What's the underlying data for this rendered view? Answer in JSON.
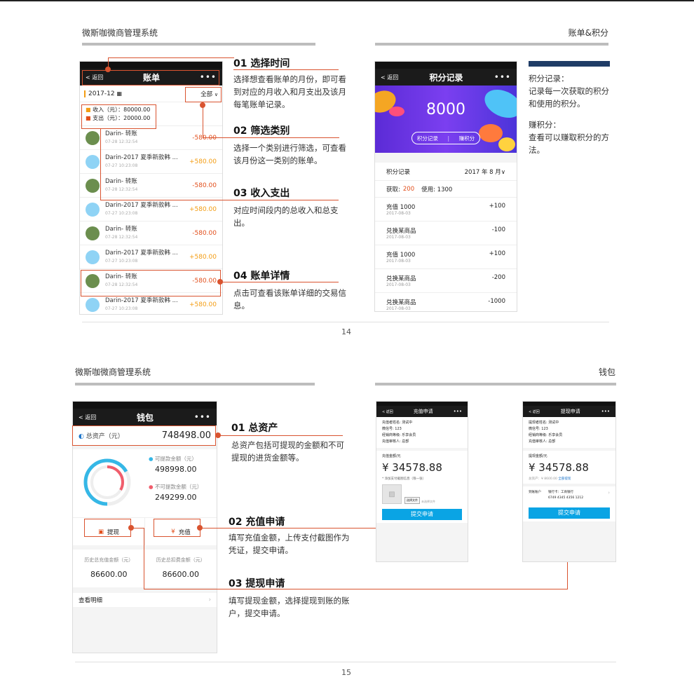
{
  "page14": {
    "left_header": "微斯咖微商管理系统",
    "right_header": "账单&积分",
    "page_number": "14",
    "bill_phone": {
      "back": "< 返回",
      "title": "账单",
      "more": "•••",
      "date": "2017-12",
      "filter": "全部",
      "income": "收入（元）：80000.00",
      "expense": "支出（元）：20000.00",
      "rows": [
        {
          "name": "Darin- 转账",
          "time": "07-28  12:32:54",
          "amount": "-580.00",
          "type": "neg"
        },
        {
          "name": "Darin-2017 夏季新款韩 ...",
          "time": "07-27  10:23:08",
          "amount": "+580.00",
          "type": "pos"
        },
        {
          "name": "Darin- 转账",
          "time": "07-28  12:32:54",
          "amount": "-580.00",
          "type": "neg"
        },
        {
          "name": "Darin-2017 夏季新款韩 ...",
          "time": "07-27  10:23:08",
          "amount": "+580.00",
          "type": "pos"
        },
        {
          "name": "Darin- 转账",
          "time": "07-28  12:32:54",
          "amount": "-580.00",
          "type": "neg"
        },
        {
          "name": "Darin-2017 夏季新款韩 ...",
          "time": "07-27  10:23:08",
          "amount": "+580.00",
          "type": "pos"
        },
        {
          "name": "Darin- 转账",
          "time": "07-28  12:32:54",
          "amount": "-580.00",
          "type": "neg"
        },
        {
          "name": "Darin-2017 夏季新款韩 ...",
          "time": "07-27  10:23:08",
          "amount": "+580.00",
          "type": "pos"
        }
      ]
    },
    "callouts": [
      {
        "title": "01 选择时间",
        "text": "选择想查看账单的月份，即可看到对应的月收入和月支出及该月每笔账单记录。"
      },
      {
        "title": "02 筛选类别",
        "text": "选择一个类别进行筛选，可查看该月份这一类别的账单。"
      },
      {
        "title": "03 收入支出",
        "text": "对应时间段内的总收入和总支出。"
      },
      {
        "title": "04 账单详情",
        "text": "点击可查看该账单详细的交易信息。"
      }
    ],
    "points_phone": {
      "back": "< 返回",
      "title": "积分记录",
      "more": "•••",
      "points": "8000",
      "btn_records": "积分记录",
      "btn_earn": "赚积分",
      "section_label": "积分记录",
      "section_date": "2017 年 8 月∨",
      "earned_label": "获取:",
      "earned_value": "200",
      "used_label": "使用: 1300",
      "rows": [
        {
          "name": "充值 1000",
          "date": "2017-08-03",
          "value": "+100"
        },
        {
          "name": "兑换某商品",
          "date": "2017-08-03",
          "value": "-100"
        },
        {
          "name": "充值 1000",
          "date": "2017-08-03",
          "value": "+100"
        },
        {
          "name": "兑换某商品",
          "date": "2017-08-03",
          "value": "-200"
        },
        {
          "name": "兑换某商品",
          "date": "2017-08-03",
          "value": "-1000"
        }
      ]
    },
    "points_desc": {
      "line1": "积分记录：",
      "line2": "记录每一次获取的积分和使用的积分。",
      "line3": "赚积分：",
      "line4": "查看可以赚取积分的方法。"
    },
    "accent_color": "#1f3c66"
  },
  "page15": {
    "left_header": "微斯咖微商管理系统",
    "right_header": "钱包",
    "page_number": "15",
    "wallet_phone": {
      "back": "< 返回",
      "title": "钱包",
      "more": "•••",
      "total_label": "总资产（元）",
      "total_value": "748498.00",
      "withdrawable_label": "可提款金额（元）",
      "withdrawable_value": "498998.00",
      "non_withdrawable_label": "不可提款金额（元）",
      "non_withdrawable_value": "249299.00",
      "btn_withdraw": "提现",
      "btn_recharge": "充值",
      "hist_recharge_label": "历史总充值金额（元）",
      "hist_recharge_value": "86600.00",
      "hist_deduct_label": "历史总扣费金额（元）",
      "hist_deduct_value": "86600.00",
      "detail_link": "查看明细"
    },
    "callouts": [
      {
        "title": "01 总资产",
        "text": "总资产包括可提现的金额和不可提现的进货金额等。"
      },
      {
        "title": "02 充值申请",
        "text": "填写充值金额，上传支付截图作为凭证，提交申请。"
      },
      {
        "title": "03 提现申请",
        "text": "填写提现金额，选择提现到账的账户，提交申请。"
      }
    ],
    "recharge_phone": {
      "back": "< 返回",
      "title": "充值申请",
      "more": "•••",
      "info": [
        "充值者姓名: 测试中",
        "微信号: 123",
        "经销商等级: 乐享会员",
        "充值审核人: 总部"
      ],
      "amount_label": "充值金额/元",
      "amount": "¥ 34578.88",
      "upload_label": "* 添加支付截图信息（限一张）",
      "choose_file": "选择文件",
      "no_file": "未选择文件",
      "submit": "提交申请"
    },
    "withdraw_phone": {
      "back": "< 返回",
      "title": "提现申请",
      "more": "•••",
      "info": [
        "提现者姓名: 测试中",
        "微信号: 123",
        "经销商等级: 乐享会员",
        "充值审核人: 总部"
      ],
      "amount_label": "提现金额/元",
      "amount": "¥ 34578.88",
      "total_hint": "总资产：¥ 8600.00",
      "withdraw_all": "全部提现",
      "account_label": "到账账户",
      "bank": "银行卡：工商银行",
      "card": "6749 4345 4356 1212",
      "submit": "提交申请"
    }
  }
}
